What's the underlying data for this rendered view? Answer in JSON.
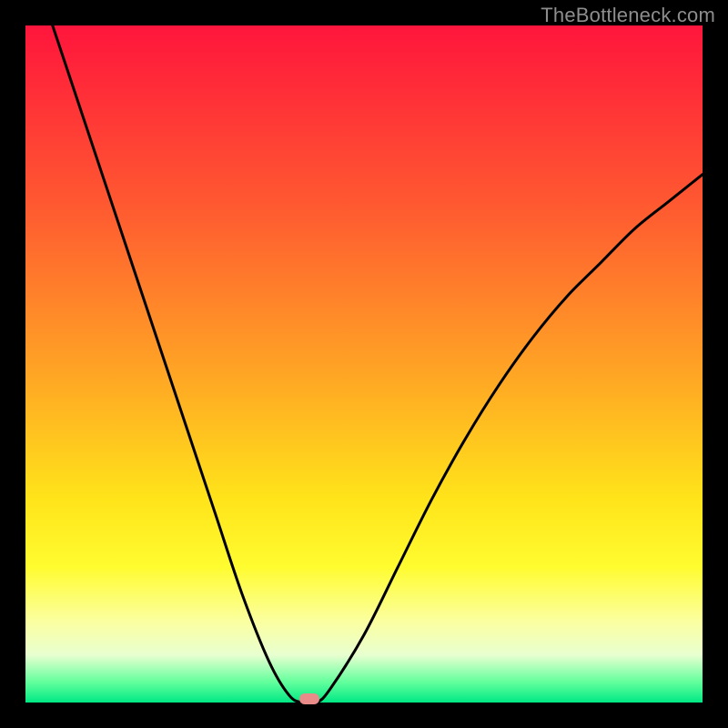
{
  "watermark": "TheBottleneck.com",
  "colors": {
    "background": "#000000",
    "gradient_top": "#ff153c",
    "gradient_mid_upper": "#ff5d30",
    "gradient_mid": "#ffe41a",
    "gradient_lower": "#fbffa0",
    "gradient_bottom": "#00e884",
    "curve": "#000000",
    "marker": "#e98b88",
    "watermark_text": "#8d8d8d"
  },
  "chart_data": {
    "type": "line",
    "title": "",
    "xlabel": "",
    "ylabel": "",
    "xlim": [
      0,
      100
    ],
    "ylim": [
      0,
      100
    ],
    "series": [
      {
        "name": "bottleneck-curve",
        "x": [
          0,
          4,
          8,
          12,
          16,
          20,
          24,
          28,
          32,
          36,
          39,
          41,
          43,
          45,
          50,
          55,
          60,
          65,
          70,
          75,
          80,
          85,
          90,
          95,
          100
        ],
        "values": [
          112,
          100,
          88,
          76,
          64,
          52,
          40,
          28,
          16,
          6,
          1,
          0,
          0,
          2,
          10,
          20,
          30,
          39,
          47,
          54,
          60,
          65,
          70,
          74,
          78
        ]
      }
    ],
    "marker": {
      "x": 42,
      "y": 0.5
    },
    "annotations": []
  }
}
